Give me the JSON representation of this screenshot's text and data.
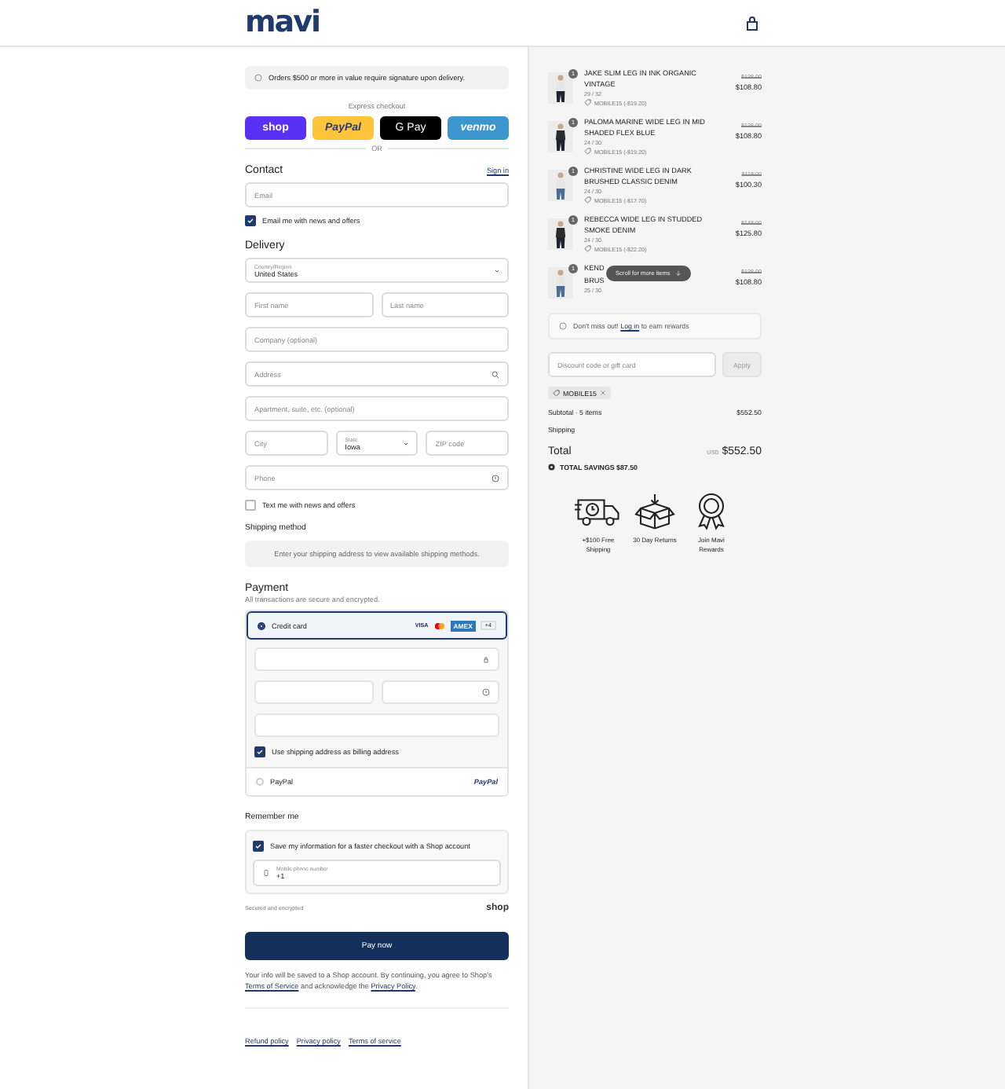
{
  "header": {
    "logo": "mavi"
  },
  "notice": "Orders $500 or more in value require signature upon delivery.",
  "express": {
    "label": "Express checkout",
    "divider": "OR",
    "buttons": [
      {
        "kind": "shop",
        "label": "shop"
      },
      {
        "kind": "paypal",
        "label": "PayPal"
      },
      {
        "kind": "gpay",
        "label": "G Pay"
      },
      {
        "kind": "venmo",
        "label": "venmo"
      }
    ]
  },
  "contact": {
    "title": "Contact",
    "link": "Sign in",
    "email_placeholder": "Email",
    "newsletter": {
      "label": "Email me with news and offers",
      "checked": true
    }
  },
  "delivery": {
    "title": "Delivery",
    "rows": [
      [
        {
          "kind": "select",
          "label": "Country/Region",
          "value": "United States"
        }
      ],
      [
        {
          "kind": "text",
          "placeholder": "First name"
        },
        {
          "kind": "text",
          "placeholder": "Last name"
        }
      ],
      [
        {
          "kind": "text",
          "placeholder": "Company (optional)"
        }
      ],
      [
        {
          "kind": "search",
          "placeholder": "Address"
        }
      ],
      [
        {
          "kind": "text",
          "placeholder": "Apartment, suite, etc. (optional)"
        }
      ],
      [
        {
          "kind": "text",
          "placeholder": "City"
        },
        {
          "kind": "select",
          "label": "State",
          "value": "Iowa"
        },
        {
          "kind": "text",
          "placeholder": "ZIP code"
        }
      ],
      [
        {
          "kind": "help",
          "placeholder": "Phone"
        }
      ]
    ],
    "sms": {
      "label": "Text me with news and offers",
      "checked": false
    }
  },
  "shipping": {
    "title": "Shipping method",
    "message": "Enter your shipping address to view available shipping methods."
  },
  "payment": {
    "title": "Payment",
    "subtitle": "All transactions are secure and encrypted.",
    "card": {
      "label": "Credit card",
      "selected": true,
      "brands": [
        {
          "kind": "visa",
          "label": "VISA"
        },
        {
          "kind": "mastercard"
        },
        {
          "kind": "amex",
          "label": "AMEX"
        },
        {
          "kind": "more",
          "label": "+4"
        }
      ]
    },
    "billing": {
      "label": "Use shipping address as billing address",
      "checked": true
    },
    "paypal": {
      "label": "PayPal",
      "selected": false,
      "logo": "PayPal"
    }
  },
  "remember": {
    "title": "Remember me",
    "save": {
      "label": "Save my information for a faster checkout with a Shop account",
      "checked": true
    },
    "phone": {
      "label": "Mobile phone number",
      "value": "+1"
    },
    "secure": "Secured and encrypted",
    "logo": "shop"
  },
  "pay_button": "Pay now",
  "legal": {
    "before": "Your info will be saved to a Shop account. By continuing, you agree to Shop's",
    "terms": "Terms of Service",
    "middle": "and acknowledge the",
    "privacy": "Privacy Policy",
    "after": "."
  },
  "footer_links": [
    "Refund policy",
    "Privacy policy",
    "Terms of service"
  ],
  "items": [
    {
      "quantity": "1",
      "name": "JAKE SLIM LEG IN INK ORGANIC VINTAGE",
      "size": "29 / 32",
      "discount": "MOBILE15 (-$19.20)",
      "old_price": "$128.00",
      "price": "$108.80"
    },
    {
      "quantity": "1",
      "name": "PALOMA MARINE WIDE LEG IN MID SHADED FLEX BLUE",
      "size": "24 / 30",
      "discount": "MOBILE15 (-$19.20)",
      "old_price": "$128.00",
      "price": "$108.80"
    },
    {
      "quantity": "1",
      "name": "CHRISTINE WIDE LEG IN DARK BRUSHED CLASSIC DENIM",
      "size": "24 / 30",
      "discount": "MOBILE15 (-$17.70)",
      "old_price": "$118.00",
      "price": "$100.30"
    },
    {
      "quantity": "1",
      "name": "REBECCA WIDE LEG IN STUDDED SMOKE DENIM",
      "size": "24 / 30",
      "discount": "MOBILE15 (-$22.20)",
      "old_price": "$148.00",
      "price": "$125.80"
    },
    {
      "quantity": "1",
      "name_lines": [
        "KEND",
        "BRUS"
      ],
      "size": "25 / 30",
      "old_price": "$128.00",
      "price": "$108.80"
    }
  ],
  "scroll_toast": "Scroll for more items",
  "rewards": {
    "before": "Don't miss out!",
    "link": "Log in",
    "after": "to earn rewards"
  },
  "discount": {
    "placeholder": "Discount code or gift card",
    "button": "Apply",
    "applied": "MOBILE15"
  },
  "summary": {
    "subtotal_label": "Subtotal · 5 items",
    "subtotal": "$552.50",
    "shipping_label": "Shipping",
    "total_label": "Total",
    "currency": "USD",
    "total": "$552.50",
    "savings": "TOTAL SAVINGS $87.50"
  },
  "perks": [
    {
      "kind": "truck",
      "label": "+$100 Free Shipping"
    },
    {
      "kind": "box",
      "label": "30 Day Returns"
    },
    {
      "kind": "medal",
      "label": "Join Mavi Rewards"
    }
  ]
}
